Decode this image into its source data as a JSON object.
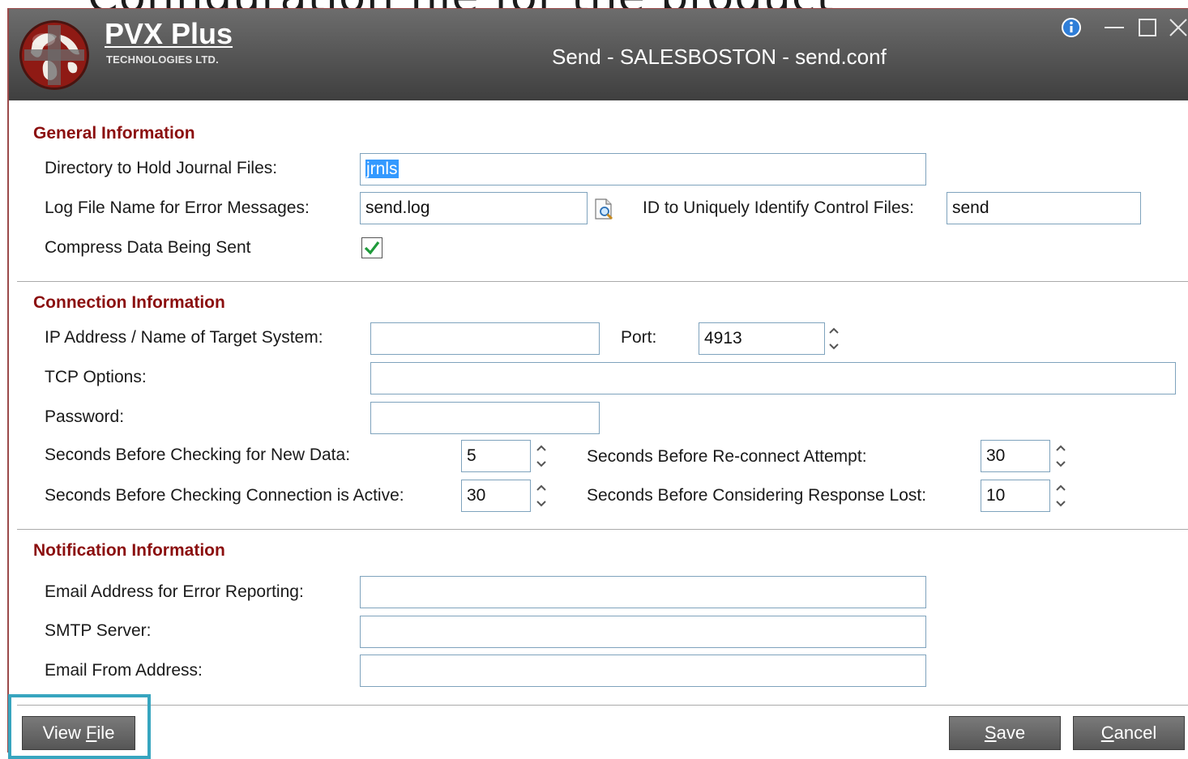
{
  "background": {
    "partial_text": "Configuration file for the product"
  },
  "titlebar": {
    "logo_name": "PVX Plus",
    "logo_subtitle": "TECHNOLOGIES LTD.",
    "title": "Send - SALESBOSTON - send.conf"
  },
  "general": {
    "title": "General Information",
    "journal_dir_label": "Directory to Hold Journal Files:",
    "journal_dir_value": "jrnls",
    "log_file_label": "Log File Name for Error Messages:",
    "log_file_value": "send.log",
    "control_id_label": "ID to Uniquely Identify Control Files:",
    "control_id_value": "send",
    "compress_label": "Compress Data Being Sent",
    "compress_checked": true
  },
  "connection": {
    "title": "Connection Information",
    "ip_label": "IP Address / Name of Target System:",
    "ip_value": "",
    "port_label": "Port:",
    "port_value": "4913",
    "tcp_label": "TCP Options:",
    "tcp_value": "",
    "password_label": "Password:",
    "password_value": "",
    "new_data_label": "Seconds Before Checking for New Data:",
    "new_data_value": "5",
    "active_label": "Seconds Before Checking Connection is Active:",
    "active_value": "30",
    "reconnect_label": "Seconds Before Re-connect Attempt:",
    "reconnect_value": "30",
    "response_lost_label": "Seconds Before Considering Response Lost:",
    "response_lost_value": "10"
  },
  "notification": {
    "title": "Notification Information",
    "email_label": "Email Address for Error Reporting:",
    "email_value": "",
    "smtp_label": "SMTP Server:",
    "smtp_value": "",
    "from_label": "Email From Address:",
    "from_value": ""
  },
  "buttons": {
    "view_file_pre": "View ",
    "view_file_key": "F",
    "view_file_post": "ile",
    "save_key": "S",
    "save_post": "ave",
    "cancel_key": "C",
    "cancel_post": "ancel"
  },
  "colors": {
    "section_title": "#8b0f0f",
    "field_border": "#7fa3bd",
    "titlebar": "#585858",
    "highlight": "#37a5bf"
  }
}
